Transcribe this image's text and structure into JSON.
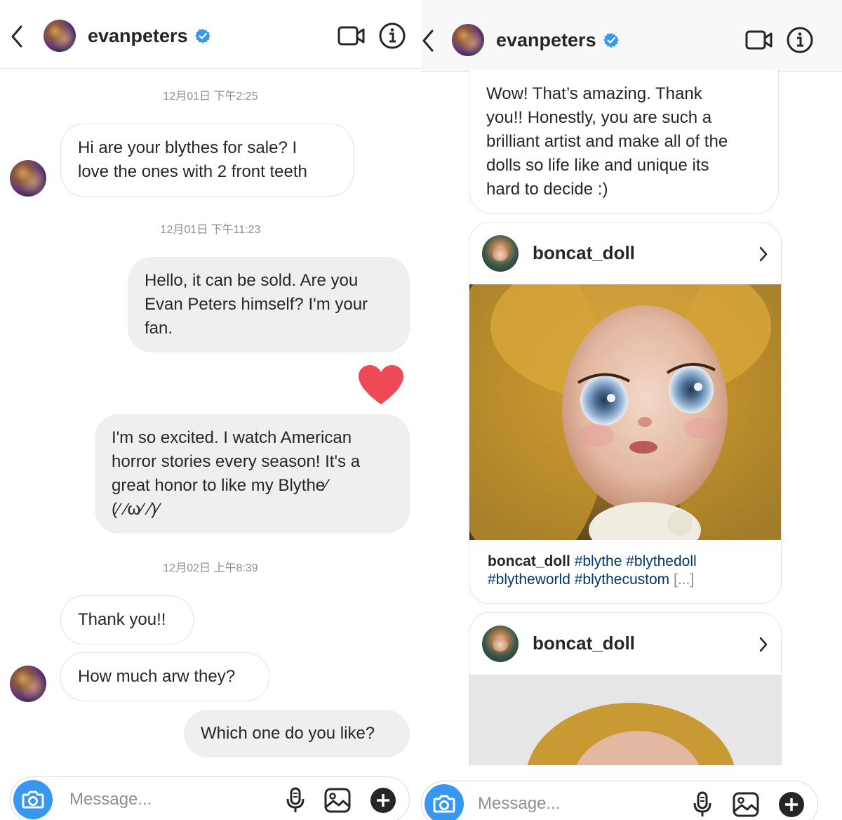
{
  "left_panel": {
    "header": {
      "username": "evanpeters",
      "icons": [
        "back-chevron-icon",
        "verified-badge-icon",
        "video-call-icon",
        "info-icon"
      ]
    },
    "timestamps": [
      "12月01日 下午2:25",
      "12月01日 下午11:23",
      "12月02日 上午8:39"
    ],
    "messages": [
      {
        "direction": "incoming",
        "lines": [
          "Hi are your blythes for sale? I",
          "love the ones with 2 front teeth"
        ]
      },
      {
        "direction": "outgoing",
        "lines": [
          "Hello, it can be sold. Are you",
          "Evan Peters himself? I'm your",
          "fan."
        ]
      },
      {
        "direction": "outgoing",
        "type": "heart",
        "icon": "heart-icon",
        "color": "#ed4956"
      },
      {
        "direction": "outgoing",
        "lines": [
          "I'm so excited. I watch American",
          "horror stories every season! It's a",
          "great honor to like my Blythe⁄",
          "(⁄ ⁄ω⁄ ⁄)⁄"
        ]
      },
      {
        "direction": "incoming",
        "lines": [
          "Thank you!!"
        ]
      },
      {
        "direction": "incoming",
        "lines": [
          "How much arw they?"
        ]
      },
      {
        "direction": "outgoing",
        "lines": [
          "Which one do you like?"
        ]
      }
    ],
    "composer": {
      "placeholder": "Message...",
      "icons": [
        "camera-icon",
        "microphone-icon",
        "gallery-icon",
        "plus-icon"
      ]
    }
  },
  "right_panel": {
    "header": {
      "username": "evanpeters"
    },
    "messages": [
      {
        "direction": "incoming",
        "lines": [
          "Wow! That’s amazing. Thank",
          "you!! Honestly, you are such a",
          "brilliant artist and make all of the",
          "dolls so life like and unique its",
          "hard to decide :)"
        ]
      }
    ],
    "shared_posts": [
      {
        "username": "boncat_doll",
        "caption_user": "boncat_doll",
        "hashtags_line1": "#blythe #blythedoll",
        "hashtags_line2": "#blytheworld #blythecustom",
        "more": "[...]"
      },
      {
        "username": "boncat_doll"
      }
    ],
    "composer": {
      "placeholder": "Message..."
    }
  },
  "colors": {
    "accent_blue": "#3897f0",
    "verified_blue": "#3897f0",
    "heart_red": "#ed4956",
    "incoming_border": "#e3e3e3",
    "outgoing_bg": "#efefef",
    "hashtag": "#00376b"
  }
}
